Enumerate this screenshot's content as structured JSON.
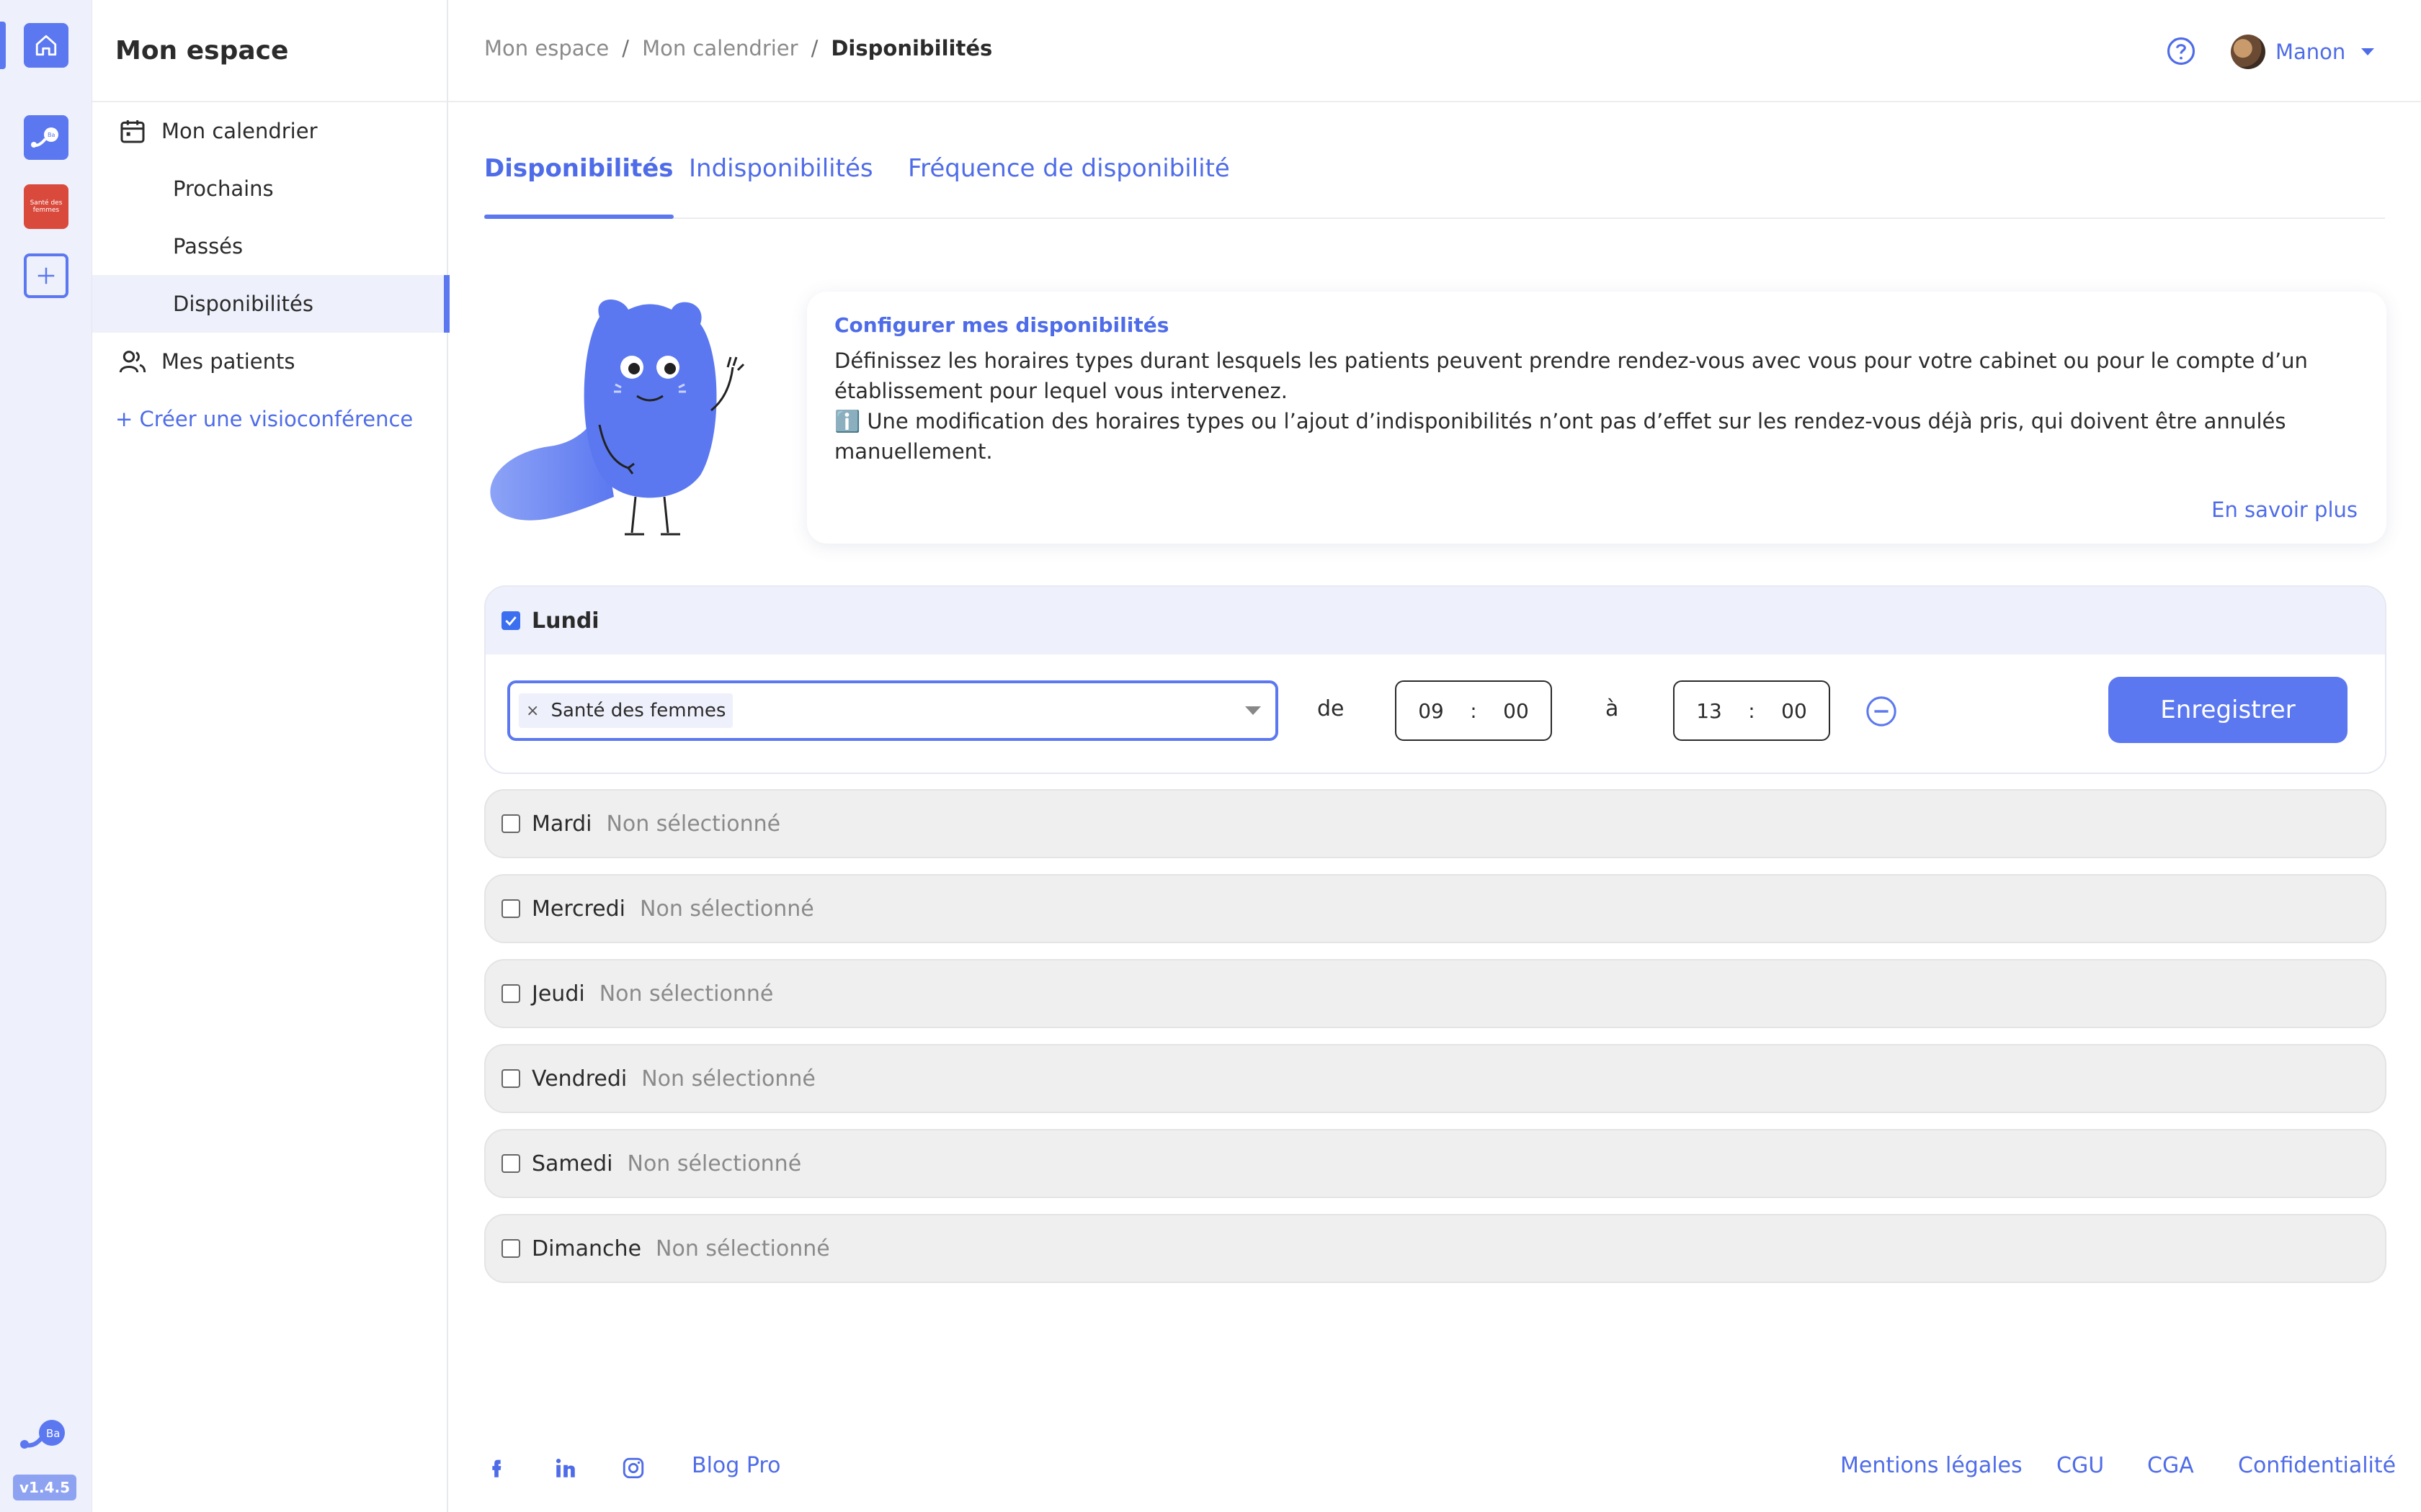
{
  "rail": {
    "app2_text": "Santé des femmes",
    "logo_text": "Ba",
    "version": "v1.4.5"
  },
  "sidebar": {
    "title": "Mon espace",
    "items": [
      {
        "label": "Mon calendrier",
        "icon": "calendar-icon"
      },
      {
        "label": "Prochains"
      },
      {
        "label": "Passés"
      },
      {
        "label": "Disponibilités",
        "active": true
      },
      {
        "label": "Mes patients",
        "icon": "users-icon"
      }
    ],
    "create_link": "+ Créer une visioconférence"
  },
  "header": {
    "breadcrumb": [
      "Mon espace",
      "Mon calendrier",
      "Disponibilités"
    ],
    "separator": "/",
    "user_name": "Manon"
  },
  "tabs": [
    {
      "label": "Disponibilités",
      "active": true
    },
    {
      "label": "Indisponibilités"
    },
    {
      "label": "Fréquence de disponibilité"
    }
  ],
  "info": {
    "title": "Configurer mes disponibilités",
    "line1": "Définissez les horaires types durant lesquels les patients peuvent prendre rendez-vous avec vous pour votre cabinet ou pour le compte d’un établissement pour lequel vous intervenez.",
    "line2": "ℹ️ Une modification des horaires types ou l’ajout d’indisponibilités n’ont pas d’effet sur les rendez-vous déjà pris, qui doivent être annulés manuellement.",
    "more": "En savoir plus"
  },
  "monday": {
    "day": "Lundi",
    "checked": true,
    "chip": "Santé des femmes",
    "chip_remove": "×",
    "from_label": "de",
    "from_h": "09",
    "from_m": "00",
    "to_label": "à",
    "to_h": "13",
    "to_m": "00",
    "time_sep": ":",
    "save": "Enregistrer"
  },
  "days": [
    {
      "name": "Mardi",
      "status": "Non sélectionné"
    },
    {
      "name": "Mercredi",
      "status": "Non sélectionné"
    },
    {
      "name": "Jeudi",
      "status": "Non sélectionné"
    },
    {
      "name": "Vendredi",
      "status": "Non sélectionné"
    },
    {
      "name": "Samedi",
      "status": "Non sélectionné"
    },
    {
      "name": "Dimanche",
      "status": "Non sélectionné"
    }
  ],
  "footer": {
    "blog": "Blog Pro",
    "links": [
      "Mentions légales",
      "CGU",
      "CGA",
      "Confidentialité"
    ]
  },
  "colors": {
    "accent": "#5b78f0",
    "link": "#4f6ce8",
    "app2": "#d94a3d"
  }
}
